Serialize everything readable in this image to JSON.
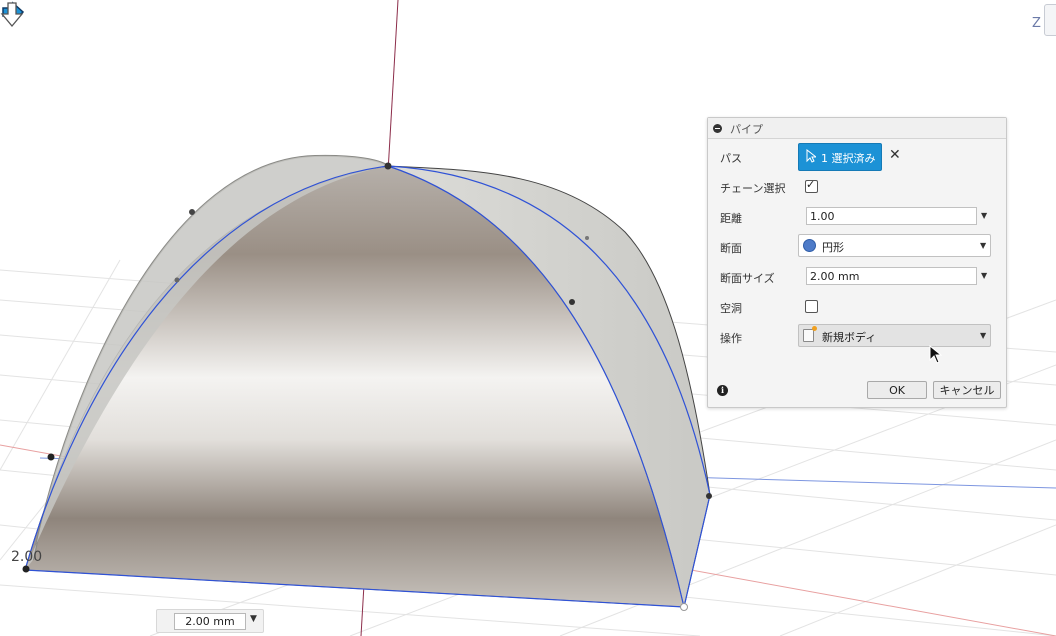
{
  "viewport": {
    "view_cube_axis": "Z",
    "dimension_value": "2.00",
    "bottom_input": {
      "value": "2.00 mm"
    }
  },
  "dialog": {
    "title": "パイプ",
    "path": {
      "label": "パス",
      "button": "1 選択済み"
    },
    "chain_select": {
      "label": "チェーン選択",
      "checked": true
    },
    "distance": {
      "label": "距離",
      "value": "1.00"
    },
    "section": {
      "label": "断面",
      "value": "円形",
      "icon": "circle-icon"
    },
    "section_size": {
      "label": "断面サイズ",
      "value": "2.00 mm"
    },
    "hollow": {
      "label": "空洞",
      "checked": false
    },
    "operation": {
      "label": "操作",
      "value": "新規ボディ",
      "icon": "new-body-icon"
    },
    "ok": "OK",
    "cancel": "キャンセル"
  },
  "colors": {
    "accent": "#1c92d6",
    "path_line": "#2f52d6",
    "section_icon": "#4e7bc8"
  }
}
